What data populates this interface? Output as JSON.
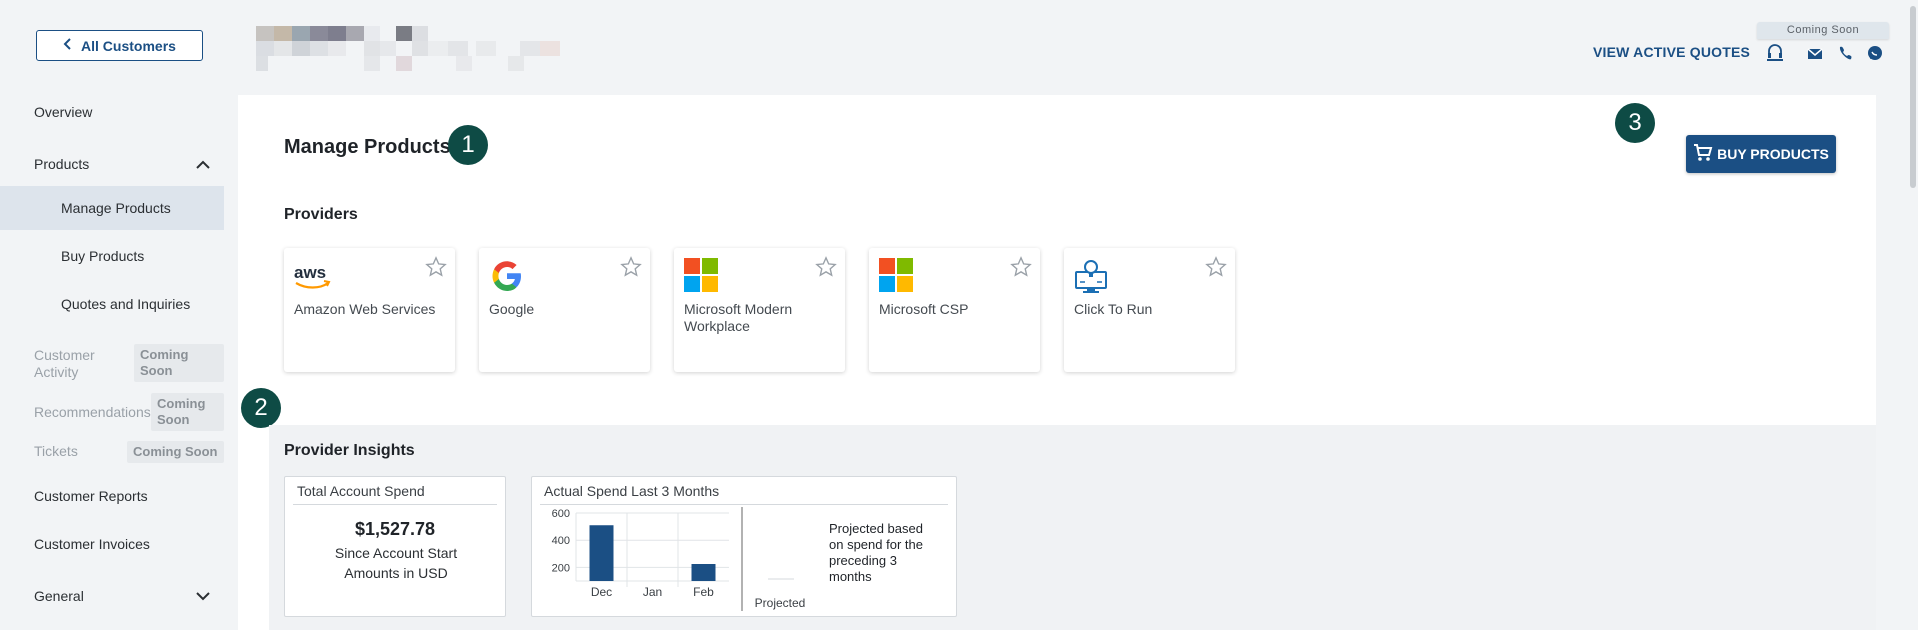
{
  "sidebar": {
    "back_label": "All Customers",
    "items": [
      {
        "label": "Overview"
      },
      {
        "label": "Products"
      },
      {
        "label": "Manage Products"
      },
      {
        "label": "Buy Products"
      },
      {
        "label": "Quotes and Inquiries"
      },
      {
        "label": "Customer Activity",
        "badge": "Coming Soon"
      },
      {
        "label": "Recommendations",
        "badge": "Coming Soon"
      },
      {
        "label": "Tickets",
        "badge": "Coming Soon"
      },
      {
        "label": "Customer Reports"
      },
      {
        "label": "Customer Invoices"
      },
      {
        "label": "General"
      }
    ]
  },
  "header": {
    "view_quotes_label": "VIEW ACTIVE QUOTES",
    "coming_soon_label": "Coming Soon",
    "icons": [
      "headset-icon",
      "email-icon",
      "phone-icon",
      "chat-icon"
    ]
  },
  "main": {
    "title": "Manage Products",
    "buy_button_label": "BUY PRODUCTS",
    "steps": [
      "1",
      "2",
      "3"
    ],
    "providers_heading": "Providers",
    "providers": [
      {
        "name": "Amazon Web Services",
        "icon": "aws-logo-icon"
      },
      {
        "name": "Google",
        "icon": "google-logo-icon"
      },
      {
        "name": "Microsoft Modern Workplace",
        "icon": "microsoft-logo-icon"
      },
      {
        "name": "Microsoft CSP",
        "icon": "microsoft-logo-icon"
      },
      {
        "name": "Click To Run",
        "icon": "click-to-run-icon"
      }
    ],
    "insights_heading": "Provider Insights",
    "total_spend": {
      "title": "Total Account Spend",
      "value": "$1,527.78",
      "subtitle_line1": "Since Account Start",
      "subtitle_line2": "Amounts in USD"
    },
    "actual_spend": {
      "title": "Actual Spend Last 3 Months",
      "projected_label": "Projected",
      "projected_note": "Projected based on spend for the preceding 3 months"
    }
  },
  "colors": {
    "primary": "#1b4f84",
    "step_badge": "#0e4b45",
    "sidebar_active": "#dde4ec",
    "bar": "#1b4f84"
  },
  "chart_data": {
    "type": "bar",
    "title": "Actual Spend Last 3 Months",
    "categories": [
      "Dec",
      "Jan",
      "Feb"
    ],
    "values": [
      510,
      100,
      225
    ],
    "y_ticks": [
      600,
      400,
      200
    ],
    "ylim": [
      100,
      600
    ],
    "grid": true
  }
}
